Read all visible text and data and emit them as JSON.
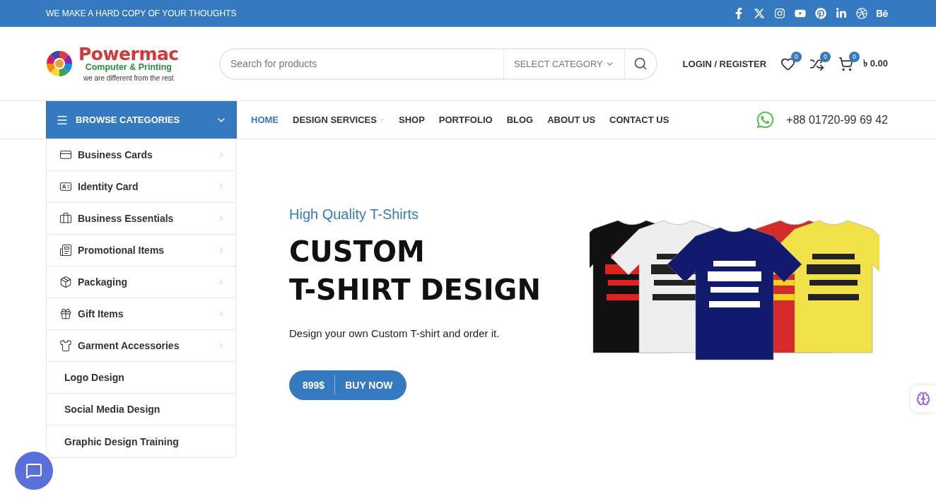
{
  "topbar": {
    "tagline": "WE MAKE A HARD COPY OF YOUR THOUGHTS"
  },
  "logo": {
    "name": "Powermac",
    "subtitle": "Computer & Printing",
    "slogan": "we are different from the rest"
  },
  "search": {
    "placeholder": "Search for products",
    "category": "SELECT CATEGORY"
  },
  "account": {
    "login": "LOGIN / REGISTER",
    "wishlist_count": "0",
    "compare_count": "0",
    "cart_count": "0",
    "cart_total": "৳ 0.00"
  },
  "browse": {
    "label": "BROWSE CATEGORIES",
    "expanded": true
  },
  "nav": [
    {
      "label": "HOME",
      "selected": true,
      "dropdown": false
    },
    {
      "label": "DESIGN SERVICES",
      "selected": false,
      "dropdown": true
    },
    {
      "label": "SHOP",
      "selected": false,
      "dropdown": false
    },
    {
      "label": "PORTFOLIO",
      "selected": false,
      "dropdown": false
    },
    {
      "label": "BLOG",
      "selected": false,
      "dropdown": false
    },
    {
      "label": "ABOUT US",
      "selected": false,
      "dropdown": false
    },
    {
      "label": "CONTACT US",
      "selected": false,
      "dropdown": false
    }
  ],
  "phone": "+88 01720-99 69 42",
  "categories": [
    {
      "label": "Business Cards",
      "kind": "submenu"
    },
    {
      "label": "Identity Card",
      "kind": "submenu"
    },
    {
      "label": "Business Essentials",
      "kind": "submenu"
    },
    {
      "label": "Promotional Items",
      "kind": "submenu"
    },
    {
      "label": "Packaging",
      "kind": "submenu"
    },
    {
      "label": "Gift Items",
      "kind": "submenu"
    },
    {
      "label": "Garment Accessories",
      "kind": "submenu"
    },
    {
      "label": "Logo Design",
      "kind": "link"
    },
    {
      "label": "Social Media Design",
      "kind": "link"
    },
    {
      "label": "Graphic Design Training",
      "kind": "link"
    }
  ],
  "hero": {
    "kicker": "High Quality T-Shirts",
    "title_lines": [
      "CUSTOM",
      "T-SHIRT DESIGN"
    ],
    "text": "Design your own Custom T-shirt and order it.",
    "price": "899$",
    "cta": "BUY NOW"
  }
}
